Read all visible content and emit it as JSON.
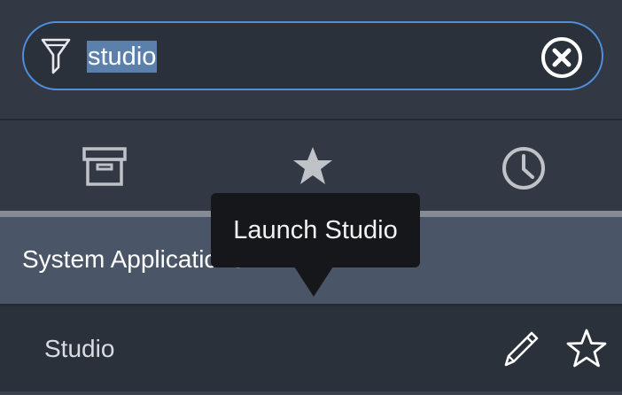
{
  "colors": {
    "background": "#2b313b",
    "header": "#323945",
    "group_header": "#4a5667",
    "focus_border": "#4e90dc",
    "selection": "#5b80ac",
    "tooltip": "#15171a",
    "icon": "#bfc3c8"
  },
  "filter": {
    "icon": "funnel-icon",
    "value": "studio",
    "clear_icon": "clear-circle-x-icon"
  },
  "tabs": [
    {
      "icon": "archive-box-icon",
      "active": true
    },
    {
      "icon": "star-filled-icon",
      "active": false
    },
    {
      "icon": "clock-icon",
      "active": false
    }
  ],
  "group": {
    "title": "System Applications"
  },
  "items": [
    {
      "label": "Studio",
      "edit_icon": "pencil-icon",
      "favorite_icon": "star-outline-icon"
    }
  ],
  "tooltip": {
    "text": "Launch Studio"
  }
}
